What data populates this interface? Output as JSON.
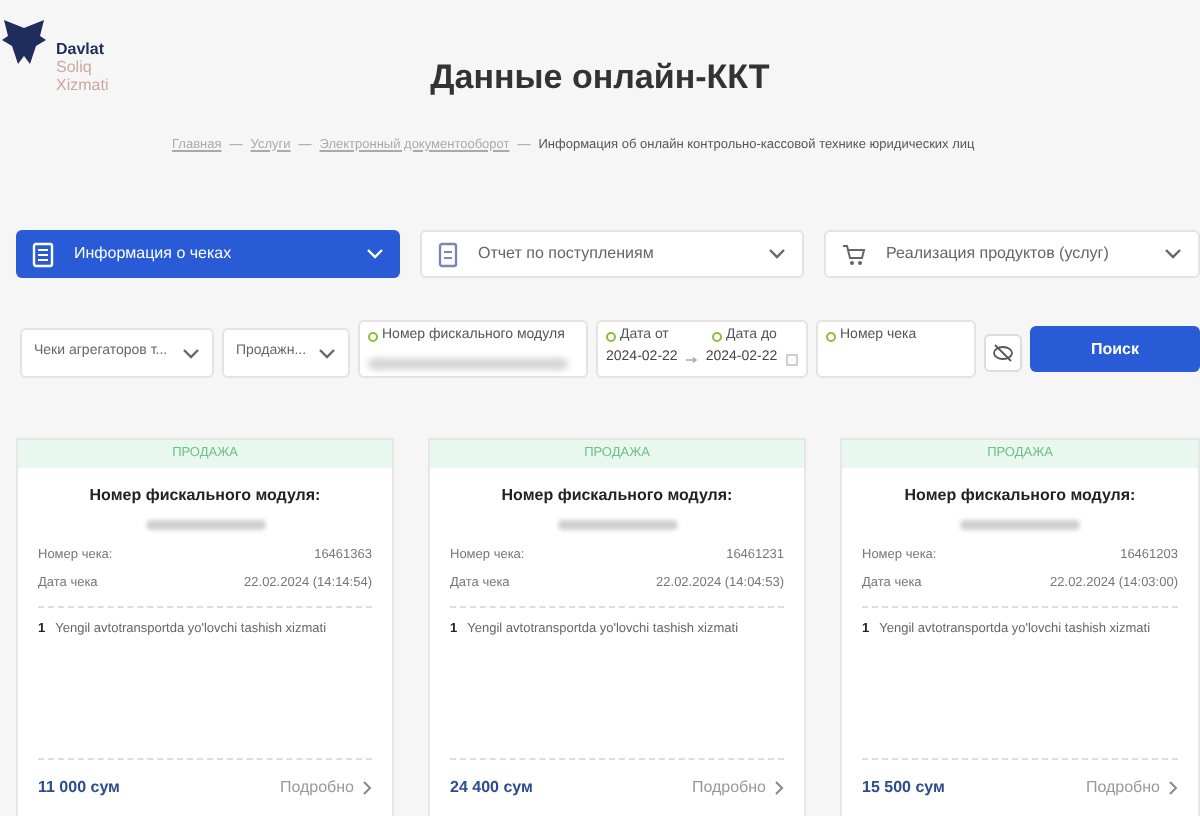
{
  "logo": {
    "lines": [
      "Davlat",
      "Soliq",
      "Xizmati"
    ]
  },
  "title": "Данные онлайн-ККТ",
  "breadcrumbs": [
    {
      "label": "Главная",
      "link": true
    },
    {
      "separator": "—",
      "label": "Услуги",
      "link": true
    },
    {
      "separator": "—",
      "label": "Электронный документооборот",
      "link": true
    },
    {
      "separator": "—",
      "label": "Информация об онлайн контрольно-кассовой технике юридических лиц",
      "link": false
    }
  ],
  "tabs": [
    {
      "label": "Информация о чеках",
      "selected": true
    },
    {
      "label": "Отчет по поступлениям",
      "selected": false
    },
    {
      "label": "Реализация продуктов (услуг)",
      "selected": false
    }
  ],
  "filters": [
    {
      "kind": "select",
      "value": "Чеки агрегаторов т..."
    },
    {
      "kind": "select",
      "value": "Продажн..."
    },
    {
      "kind": "field",
      "label": "Номер фискального модуля",
      "redacted": true
    },
    {
      "kind": "daterange",
      "from_label": "Дата от",
      "from": "2024-02-22",
      "to_label": "Дата до",
      "to": "2024-02-22"
    },
    {
      "kind": "field",
      "label": "Номер чека",
      "redacted": false
    },
    {
      "kind": "iconbutton"
    },
    {
      "kind": "button",
      "label": "Поиск"
    }
  ],
  "cards": [
    {
      "type": "ПРОДАЖА",
      "heading": "Номер фискального модуля:",
      "number_label": "Номер чека:",
      "number": "16461363",
      "date_label": "Дата чека",
      "date": "22.02.2024 (14:14:54)",
      "items": [
        {
          "index": "1",
          "name": "Yengil avtotransportda yo'lovchi tashish xizmati"
        }
      ],
      "total": "11 000 сум",
      "more": "Подробно"
    },
    {
      "type": "ПРОДАЖА",
      "heading": "Номер фискального модуля:",
      "number_label": "Номер чека:",
      "number": "16461231",
      "date_label": "Дата чека",
      "date": "22.02.2024 (14:04:53)",
      "items": [
        {
          "index": "1",
          "name": "Yengil avtotransportda yo'lovchi tashish xizmati"
        }
      ],
      "total": "24 400 сум",
      "more": "Подробно"
    },
    {
      "type": "ПРОДАЖА",
      "heading": "Номер фискального модуля:",
      "number_label": "Номер чека:",
      "number": "16461203",
      "date_label": "Дата чека",
      "date": "22.02.2024 (14:03:00)",
      "items": [
        {
          "index": "1",
          "name": "Yengil avtotransportda yo'lovchi tashish xizmati"
        }
      ],
      "total": "15 500 сум",
      "more": "Подробно"
    }
  ]
}
